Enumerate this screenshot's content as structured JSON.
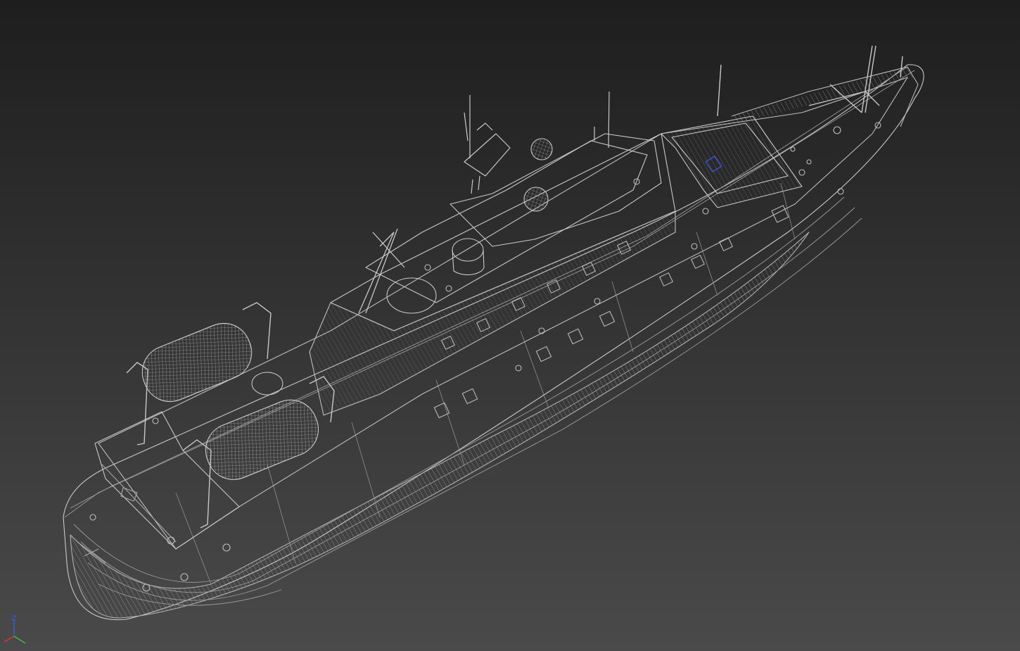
{
  "viewport": {
    "background_top": "#1e1e1e",
    "background_bottom": "#4a4a4a",
    "wire_color": "#c8c8c8",
    "wire_dim_color": "#8e8e8e",
    "selection_color": "#3a52d8"
  },
  "model": {
    "object": "ship-hull-wireframe",
    "render_mode": "wireframe"
  },
  "axis_gizmo": {
    "x_color": "#d23a3a",
    "y_color": "#3ac23a",
    "z_color": "#3a5ad8"
  }
}
